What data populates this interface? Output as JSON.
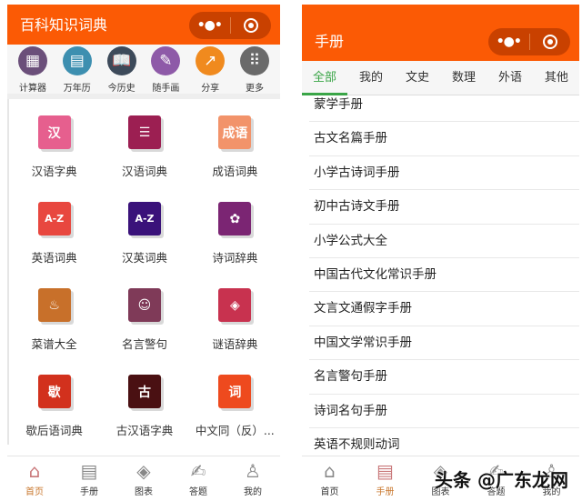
{
  "left": {
    "title": "百科知识词典",
    "capsule": {
      "menu": "•●•"
    },
    "quick": [
      {
        "label": "计算器",
        "icon": "calculator-icon",
        "glyph": "▦",
        "color": "#6b4f7a"
      },
      {
        "label": "万年历",
        "icon": "calendar-icon",
        "glyph": "▤",
        "color": "#3d8fb0"
      },
      {
        "label": "今历史",
        "icon": "book-open-icon",
        "glyph": "📖",
        "color": "#3d4a5a"
      },
      {
        "label": "随手画",
        "icon": "pencil-icon",
        "glyph": "✎",
        "color": "#8e5aa8"
      },
      {
        "label": "分享",
        "icon": "share-icon",
        "glyph": "↗",
        "color": "#f08a1e"
      },
      {
        "label": "更多",
        "icon": "more-grid-icon",
        "glyph": "⠿",
        "color": "#6a6a6a"
      }
    ],
    "grid": [
      {
        "label": "汉语字典",
        "glyph": "汉",
        "color": "#e65f8e"
      },
      {
        "label": "汉语词典",
        "glyph": "☰",
        "color": "#9c1f52"
      },
      {
        "label": "成语词典",
        "glyph": "成语",
        "color": "#f2936a"
      },
      {
        "label": "英语词典",
        "glyph": "A-Z",
        "color": "#e8473f"
      },
      {
        "label": "汉英词典",
        "glyph": "A-Z",
        "color": "#3a127a"
      },
      {
        "label": "诗词辞典",
        "glyph": "✿",
        "color": "#7b2573"
      },
      {
        "label": "菜谱大全",
        "glyph": "♨",
        "color": "#c8702a"
      },
      {
        "label": "名言警句",
        "glyph": "☺",
        "color": "#7f3a58"
      },
      {
        "label": "谜语辞典",
        "glyph": "◈",
        "color": "#c8324f"
      },
      {
        "label": "歇后语词典",
        "glyph": "歇",
        "color": "#d2311d"
      },
      {
        "label": "古汉语字典",
        "glyph": "古",
        "color": "#4a1012"
      },
      {
        "label": "中文同（反）...",
        "glyph": "词",
        "color": "#ee4a1e"
      }
    ],
    "tabbar": [
      {
        "label": "首页",
        "glyph": "⌂",
        "active": true
      },
      {
        "label": "手册",
        "glyph": "▤"
      },
      {
        "label": "图表",
        "glyph": "◈"
      },
      {
        "label": "答题",
        "glyph": "✍"
      },
      {
        "label": "我的",
        "glyph": "♙"
      }
    ]
  },
  "right": {
    "title": "手册",
    "capsule": {
      "menu": "•●•"
    },
    "tabs": [
      "全部",
      "我的",
      "文史",
      "数理",
      "外语",
      "其他"
    ],
    "items": [
      "蒙学手册",
      "古文名篇手册",
      "小学古诗词手册",
      "初中古诗文手册",
      "小学公式大全",
      "中国古代文化常识手册",
      "文言文通假字手册",
      "中国文学常识手册",
      "名言警句手册",
      "诗词名句手册",
      "英语不规则动词"
    ],
    "tabbar": [
      {
        "label": "首页",
        "glyph": "⌂"
      },
      {
        "label": "手册",
        "glyph": "▤",
        "active": true
      },
      {
        "label": "图表",
        "glyph": "◈"
      },
      {
        "label": "答题",
        "glyph": "✍"
      },
      {
        "label": "我的",
        "glyph": "♙"
      }
    ]
  },
  "watermark": "头条 @广东龙网"
}
